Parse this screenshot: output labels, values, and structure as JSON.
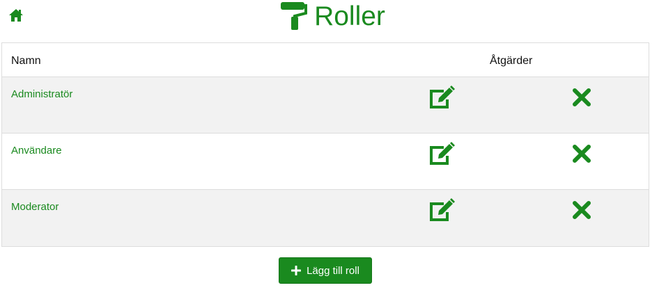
{
  "header": {
    "title": "Roller",
    "home_icon": "home-icon",
    "title_icon": "paint-roller-icon"
  },
  "table": {
    "columns": [
      "Namn",
      "Åtgärder"
    ],
    "rows": [
      {
        "name": "Administratör",
        "edit_icon": "edit-icon",
        "delete_icon": "close-icon"
      },
      {
        "name": "Användare",
        "edit_icon": "edit-icon",
        "delete_icon": "close-icon"
      },
      {
        "name": "Moderator",
        "edit_icon": "edit-icon",
        "delete_icon": "close-icon"
      }
    ]
  },
  "actions": {
    "add_label": "Lägg till roll",
    "add_icon": "plus-icon"
  },
  "colors": {
    "accent": "#1a8a1f",
    "row_stripe": "#f2f2f2",
    "border": "#dddddd"
  }
}
